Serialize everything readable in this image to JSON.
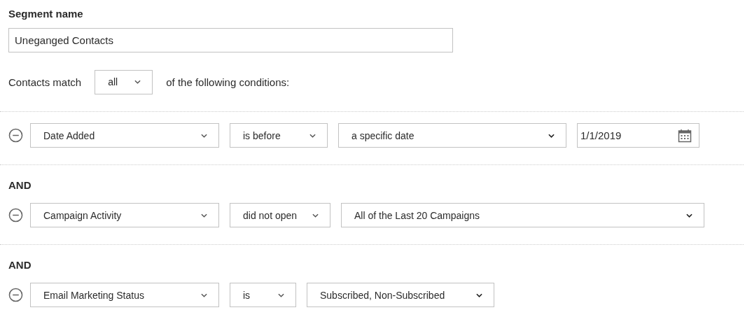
{
  "segment_name": {
    "label": "Segment name",
    "value": "Uneganged Contacts"
  },
  "match": {
    "label": "Contacts match",
    "value": "all",
    "suffix": "of the following conditions:"
  },
  "conditions": [
    {
      "field": "Date Added",
      "operator": "is before",
      "value": "a specific date",
      "date": "1/1/2019"
    },
    {
      "connector": "AND",
      "field": "Campaign Activity",
      "operator": "did not open",
      "value": "All of the Last 20 Campaigns"
    },
    {
      "connector": "AND",
      "field": "Email Marketing Status",
      "operator": "is",
      "value": "Subscribed, Non-Subscribed"
    }
  ]
}
